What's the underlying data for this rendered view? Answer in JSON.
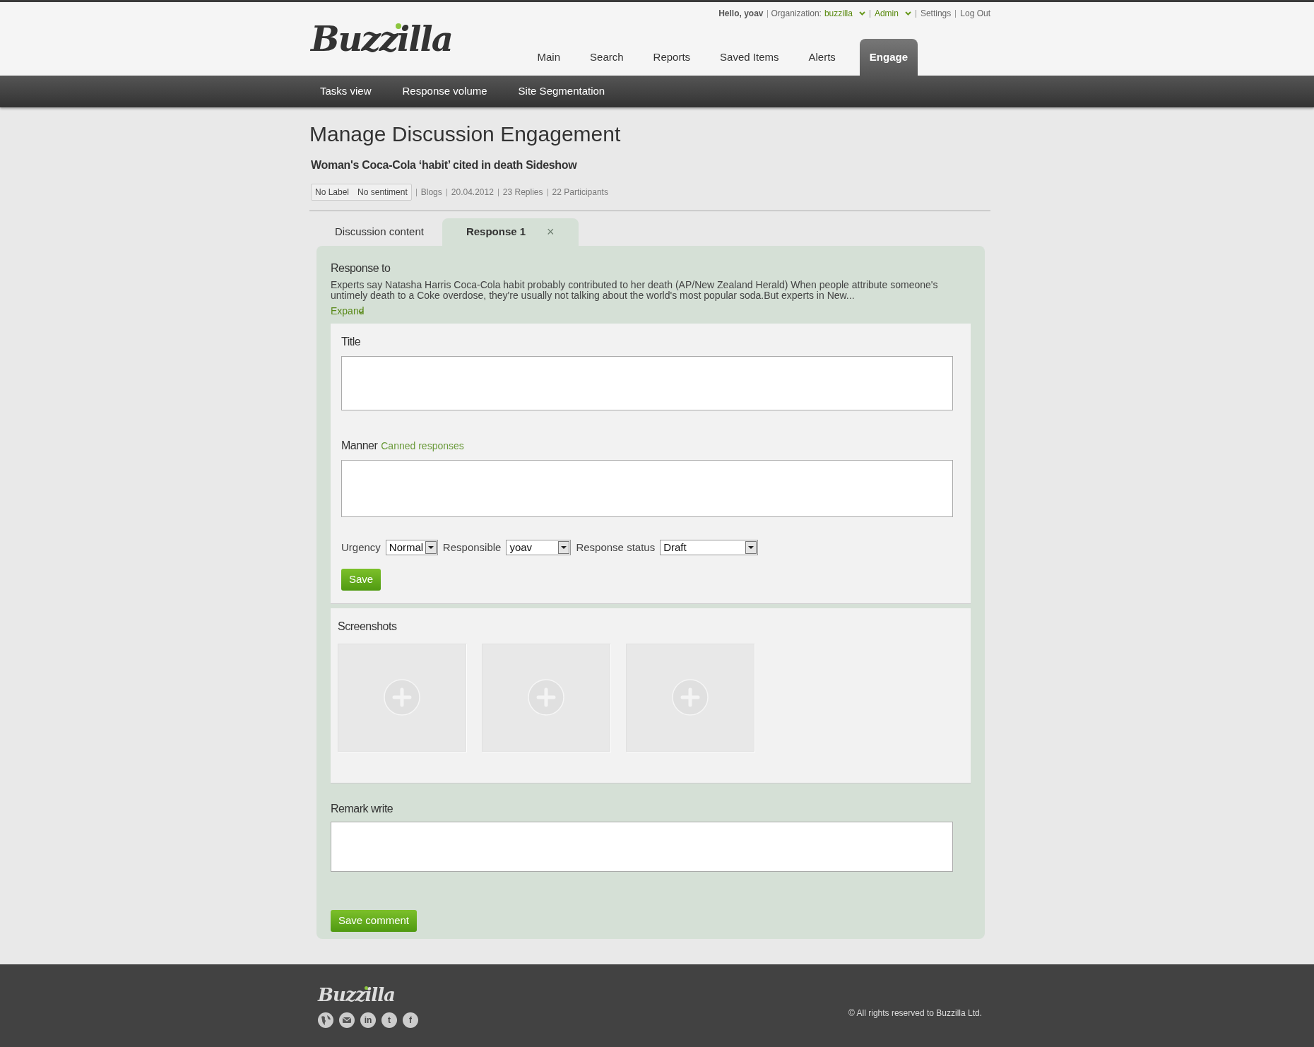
{
  "top_bar": {
    "greeting": "Hello, yoav",
    "organization_label": "Organization:",
    "organization": "buzzilla",
    "role": "Admin",
    "links": [
      "Settings",
      "Log Out"
    ]
  },
  "logo": "Buzzilla",
  "nav_tabs": [
    {
      "label": "Main",
      "selected": false
    },
    {
      "label": "Search",
      "selected": false
    },
    {
      "label": "Reports",
      "selected": false
    },
    {
      "label": "Saved Items",
      "selected": false
    },
    {
      "label": "Alerts",
      "selected": false
    },
    {
      "label": "Engage",
      "selected": true
    }
  ],
  "sub_nav": [
    "Tasks view",
    "Response volume",
    "Site Segmentation"
  ],
  "page_title": "Manage Discussion Engagement",
  "discussion": {
    "title": "Woman's Coca-Cola ‘habit’ cited in death Sideshow",
    "tags": [
      "No Label",
      "No sentiment"
    ],
    "meta": [
      "Blogs",
      "20.04.2012",
      "23 Replies",
      "22 Participants"
    ]
  },
  "tabs": [
    {
      "label": "Discussion content",
      "selected": false
    },
    {
      "label": "Response 1",
      "selected": true,
      "close": "×"
    }
  ],
  "response_to": {
    "label": "Response to",
    "text": "Experts say Natasha Harris Coca-Cola habit probably contributed to her death (AP/New Zealand Herald) When people attribute someone's untimely death to a Coke overdose, they're usually not talking about the world's most popular soda.But experts in New...",
    "expand": "Expand"
  },
  "form": {
    "title_label": "Title",
    "manner_label": "Manner",
    "canned_link": "Canned responses",
    "selects": [
      {
        "label": "Urgency",
        "value": "Normal"
      },
      {
        "label": "Responsible",
        "value": "yoav"
      },
      {
        "label": "Response status",
        "value": "Draft"
      }
    ],
    "save": "Save"
  },
  "screenshots": {
    "label": "Screenshots",
    "slots": [
      {
        "kind": "empty"
      },
      {
        "kind": "empty"
      },
      {
        "kind": "empty"
      }
    ]
  },
  "remark": {
    "label": "Remark write",
    "button": "Save comment"
  },
  "footer": {
    "logo": "Buzzilla",
    "social": [
      {
        "kind": "globe"
      },
      {
        "kind": "mail"
      },
      {
        "kind": "letter",
        "text": "in"
      },
      {
        "kind": "letter",
        "text": "t"
      },
      {
        "kind": "letter",
        "text": "f"
      }
    ],
    "copyright": "© All rights reserved to Buzzilla Ltd."
  }
}
